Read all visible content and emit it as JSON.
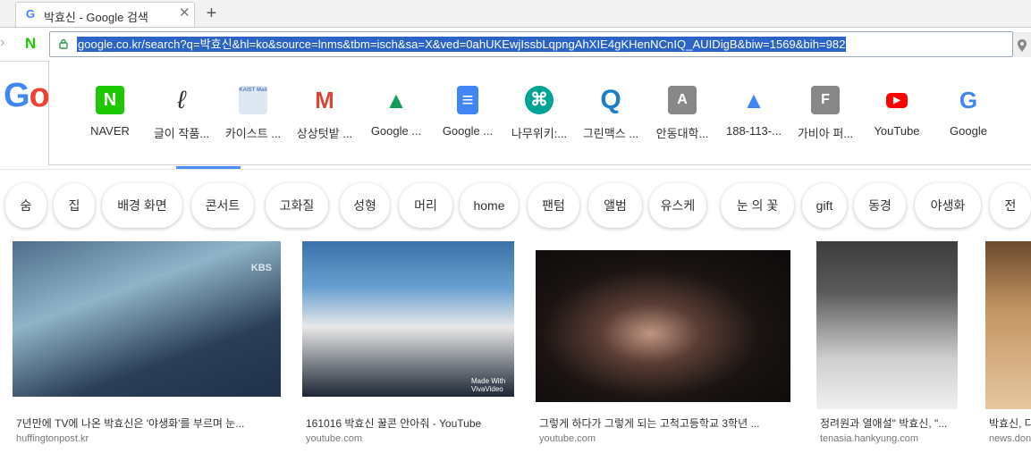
{
  "tab": {
    "title": "박효신 - Google 검색",
    "favicon": "G",
    "close": "✕",
    "new_tab": "+"
  },
  "address": {
    "url": "google.co.kr/search?q=박효신&hl=ko&source=lnms&tbm=isch&sa=X&ved=0ahUKEwjIssbLqpngAhXIE4gKHenNCnIQ_AUIDigB&biw=1569&bih=982"
  },
  "toolbar": {
    "naver_letter": "N",
    "back": "›"
  },
  "logo": {
    "g": "G",
    "o": "o"
  },
  "shortcuts": [
    {
      "label": "NAVER",
      "icon": "naver-icon",
      "color": "#1ec800",
      "glyph": "N"
    },
    {
      "label": "글이 작품...",
      "icon": "signature-icon",
      "color": "#333333",
      "glyph": "ℓ"
    },
    {
      "label": "카이스트 ...",
      "icon": "kaist-mail-icon",
      "color": "#5a7fb5",
      "glyph": "KAIST Mail"
    },
    {
      "label": "상상텃밭 ...",
      "icon": "gmail-icon",
      "color": "#d14836",
      "glyph": "M"
    },
    {
      "label": "Google ...",
      "icon": "google-drive-icon",
      "color": "#0f9d58",
      "glyph": "▲"
    },
    {
      "label": "Google ...",
      "icon": "google-docs-icon",
      "color": "#4285f4",
      "glyph": "≡"
    },
    {
      "label": "나무위키:...",
      "icon": "namuwiki-icon",
      "color": "#00a495",
      "glyph": "⌘"
    },
    {
      "label": "그린맥스 ...",
      "icon": "greenmax-icon",
      "color": "#1a7ec8",
      "glyph": "Q"
    },
    {
      "label": "안동대학...",
      "icon": "letter-a-icon",
      "color": "#888888",
      "glyph": "A"
    },
    {
      "label": "188-113-...",
      "icon": "google-ads-icon",
      "color": "#4285f4",
      "glyph": "▲"
    },
    {
      "label": "가비아 퍼...",
      "icon": "letter-f-icon",
      "color": "#888888",
      "glyph": "F"
    },
    {
      "label": "YouTube",
      "icon": "youtube-icon",
      "color": "#ff0000",
      "glyph": "▶"
    },
    {
      "label": "Google",
      "icon": "google-icon",
      "color": "#4285f4",
      "glyph": "G"
    }
  ],
  "chips": [
    "숨",
    "집",
    "배경 화면",
    "콘서트",
    "고화질",
    "성형",
    "머리",
    "home",
    "팬텀",
    "앨범",
    "유스케",
    "눈 의 꽃",
    "gift",
    "동경",
    "야생화",
    "전"
  ],
  "results": [
    {
      "caption": "7년만에 TV에 나온 박효신은 '야생화'를 부르며 눈...",
      "source": "huffingtonpost.kr",
      "overlay": "KBS"
    },
    {
      "caption": "161016 박효신 꿀콘 안아줘 - YouTube",
      "source": "youtube.com",
      "overlay": "Made With VivaVideo"
    },
    {
      "caption": "그렇게 하다가 그렇게 되는 고척고등학교 3학년 ...",
      "source": "youtube.com",
      "overlay": ""
    },
    {
      "caption": "정려원과 열애설\" 박효신, \"...",
      "source": "tenasia.hankyung.com",
      "overlay": ""
    },
    {
      "caption": "박효신, 다",
      "source": "news.don",
      "overlay": ""
    }
  ]
}
